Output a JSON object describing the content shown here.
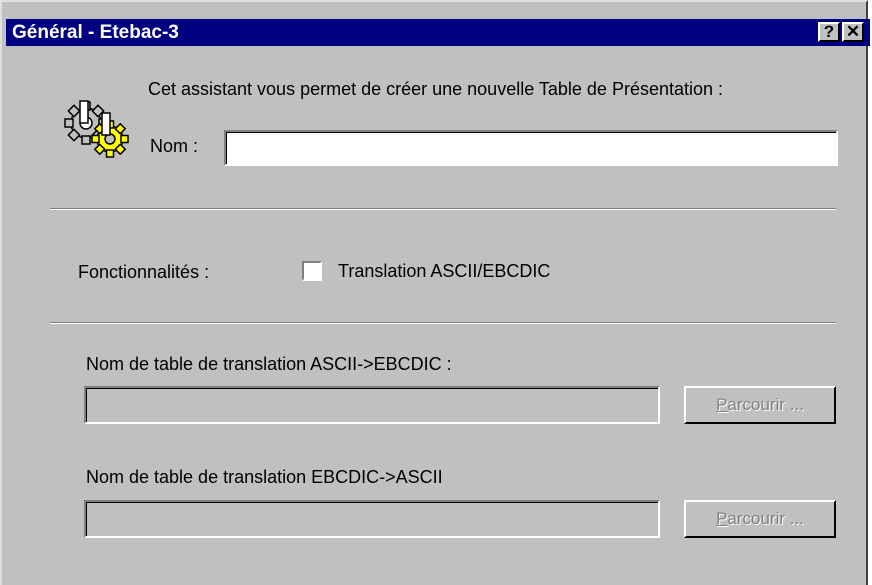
{
  "window": {
    "title": "Général - Etebac-3",
    "help_button": "?",
    "close_button": "✕"
  },
  "intro": {
    "text": "Cet assistant vous permet de créer une nouvelle Table de Présentation :",
    "icon": "gears-icon"
  },
  "name_field": {
    "label": "Nom :",
    "value": ""
  },
  "features": {
    "label": "Fonctionnalités :",
    "checkbox_label": "Translation ASCII/EBCDIC",
    "checked": false
  },
  "ascii_to_ebcdic": {
    "label": "Nom de table de translation ASCII->EBCDIC :",
    "value": "",
    "browse_label_first": "P",
    "browse_label_rest": "arcourir ..."
  },
  "ebcdic_to_ascii": {
    "label": "Nom de table de translation EBCDIC->ASCII",
    "value": "",
    "browse_label_first": "P",
    "browse_label_rest": "arcourir ..."
  }
}
